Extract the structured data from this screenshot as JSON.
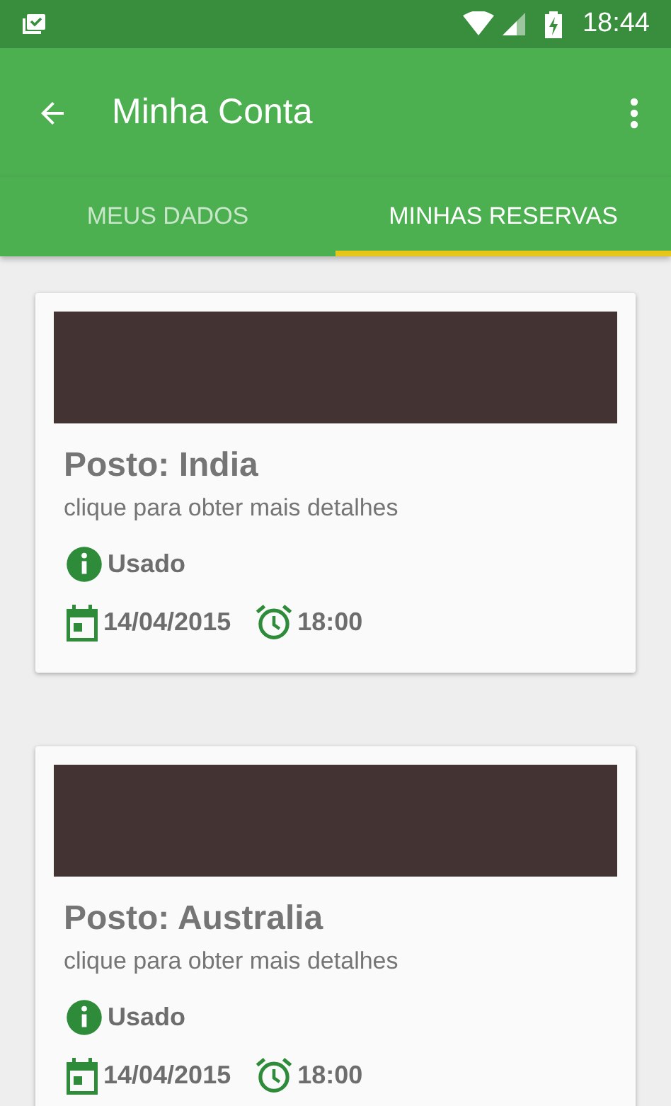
{
  "status_bar": {
    "time": "18:44"
  },
  "app_bar": {
    "title": "Minha Conta"
  },
  "tabs": [
    {
      "label": "MEUS DADOS",
      "selected": false
    },
    {
      "label": "MINHAS RESERVAS",
      "selected": true
    }
  ],
  "reservations": [
    {
      "title": "Posto: India",
      "subtitle": "clique para obter mais detalhes",
      "status": "Usado",
      "date": "14/04/2015",
      "time": "18:00"
    },
    {
      "title": "Posto: Australia",
      "subtitle": "clique para obter mais detalhes",
      "status": "Usado",
      "date": "14/04/2015",
      "time": "18:00"
    }
  ]
}
